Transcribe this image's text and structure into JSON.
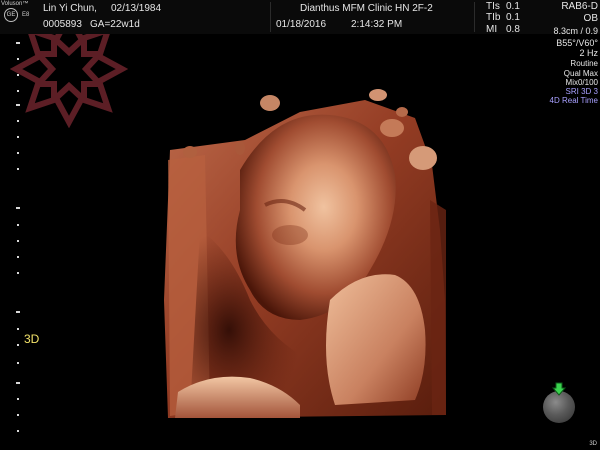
{
  "header": {
    "brand": "Voluson™",
    "ge_mark": "GE",
    "e8_label": "E8",
    "patient_name": "Lin Yi Chun,",
    "patient_dob": "02/13/1984",
    "patient_id": "0005893",
    "gestational_age": "GA=22w1d",
    "clinic": "Dianthus MFM Clinic HN 2F-2",
    "date": "01/18/2016",
    "time": "2:14:32 PM"
  },
  "indices": {
    "tis_label": "TIs",
    "tis_value": "0.1",
    "tib_label": "TIb",
    "tib_value": "0.1",
    "mi_label": "MI",
    "mi_value": "0.8"
  },
  "probe_settings": {
    "probe": "RAB6-D",
    "preset": "OB",
    "depth_ratio": "8.3cm / 0.9",
    "angles": "B55°/V60°",
    "frequency": "2 Hz",
    "mode": "Routine",
    "quality": "Qual Max",
    "mix": "Mix0/100",
    "sri": "SRI 3D 3",
    "realtime": "4D Real Time"
  },
  "view": {
    "mode_label": "3D",
    "corner_label": "3D"
  },
  "icons": {
    "logo": "snowflake-logo-icon",
    "ge": "ge-logo-icon",
    "trackball": "trackball-icon",
    "cursor": "green-arrow-icon"
  },
  "colors": {
    "background": "#000000",
    "tissue_dark": "#5a1d0e",
    "tissue_mid": "#b45e41",
    "tissue_light": "#e9b08c",
    "logo": "#5c1e25",
    "highlight_purple": "#a8a0ff",
    "mode_yellow": "#f3e36a",
    "cursor_green": "#3ad24f"
  }
}
